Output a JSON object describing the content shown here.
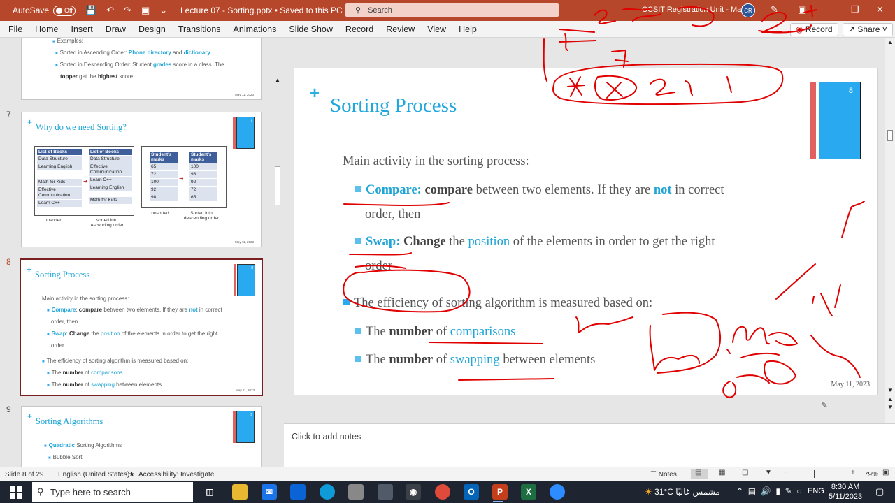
{
  "titlebar": {
    "autosave": "AutoSave",
    "toggle": "Off",
    "doc_title": "Lecture 07 - Sorting.pptx  •  Saved to this PC ˅",
    "search_placeholder": "Search",
    "account": "CCSIT Registration Unit - Male",
    "avatar": "CR"
  },
  "ribbon": {
    "tabs": [
      "File",
      "Home",
      "Insert",
      "Draw",
      "Design",
      "Transitions",
      "Animations",
      "Slide Show",
      "Record",
      "Review",
      "View",
      "Help"
    ],
    "record_btn": "Record",
    "share_btn": "Share"
  },
  "thumbs": {
    "n6": {
      "l1": "Examples:",
      "l2a": "Sorted in Ascending Order: ",
      "l2b": "Phone directory",
      "l2c": " and ",
      "l2d": "dictionary",
      "l3a": "Sorted in Descending Order: Student ",
      "l3b": "grades",
      "l3c": " score in a class.  The",
      "l4a": "topper",
      "l4b": " get the ",
      "l4c": "highest",
      "l4d": " score.",
      "date": "May 11, 2023"
    },
    "n7": {
      "num": "7",
      "title": "Why do we need Sorting?",
      "box_num": "7",
      "date": "May 11, 2023",
      "books_head": "List of Books",
      "books_unsorted": [
        "Data Structure",
        "Learning English",
        "Math for Kids",
        "Effective Communication",
        "Learn C++"
      ],
      "books_sorted": [
        "Data Structure",
        "Effective Communication",
        "Learn C++",
        "Learning English",
        "Math for Kids"
      ],
      "marks_head": "Student's marks",
      "marks_unsorted": [
        "65",
        "72",
        "100",
        "92",
        "98"
      ],
      "marks_sorted": [
        "100",
        "98",
        "92",
        "72",
        "65"
      ],
      "cap_unsorted": "unsorted",
      "cap_asc": "sorted into Ascending order",
      "cap_unsorted2": "unsorted",
      "cap_desc": "Sorted into descending order"
    },
    "n8": {
      "num": "8",
      "title": "Sorting Process",
      "box_num": "8",
      "l1": "Main activity in the sorting process:",
      "l2a": "Compare",
      "l2b": ": ",
      "l2c": "compare",
      "l2d": " between two elements. If they are ",
      "l2e": "not",
      "l2f": " in correct",
      "l3": "order, then",
      "l4a": "Swap",
      "l4b": ": ",
      "l4c": "Change",
      "l4d": " the ",
      "l4e": "position",
      "l4f": " of the elements in order to get the right",
      "l5": "order",
      "l6": "The efficiency of sorting algorithm is measured based on:",
      "l7a": "The ",
      "l7b": "number",
      "l7c": " of ",
      "l7d": "comparisons",
      "l8a": "The ",
      "l8b": "number",
      "l8c": " of ",
      "l8d": "swapping",
      "l8e": " between elements",
      "date": "May 11, 2023"
    },
    "n9": {
      "num": "9",
      "title": "Sorting Algorithms",
      "box_num": "9",
      "l1a": "Quadratic",
      "l1b": " Sorting Algorithms",
      "l2": "Bubble Sort"
    }
  },
  "slide": {
    "title": "Sorting Process",
    "box_num": "8",
    "main": "Main activity in the sorting process:",
    "compare_label": "Compare:",
    "compare_word": "compare",
    "compare_text1": " between two elements. If they are ",
    "compare_not": "not",
    "compare_text2": " in correct",
    "compare_line2": "order, then",
    "swap_label": "Swap:",
    "swap_change": "Change",
    "swap_text1": " the ",
    "swap_position": "position",
    "swap_text2": " of the elements in order to get the right",
    "swap_line2": "order",
    "efficiency": "The efficiency of sorting algorithm is measured based on:",
    "m1_the": "The ",
    "m1_number": "number",
    "m1_of": " of ",
    "m1_what": "comparisons",
    "m2_the": "The ",
    "m2_number": "number",
    "m2_of": " of ",
    "m2_what": "swapping",
    "m2_rest": " between elements",
    "date": "May 11, 2023"
  },
  "notes_placeholder": "Click to add notes",
  "status": {
    "slide_of": "Slide 8 of 29",
    "language": "English (United States)",
    "accessibility": "Accessibility: Investigate",
    "notes": "Notes",
    "zoom": "79%"
  },
  "taskbar": {
    "search_placeholder": "Type here to search",
    "weather": "31°C  مشمس غالبًا",
    "lang": "ENG",
    "time": "8:30 AM",
    "date": "5/11/2023"
  },
  "colors": {
    "accent": "#b7472a",
    "slide_title": "#22a7dc",
    "ink": "#e00000"
  }
}
